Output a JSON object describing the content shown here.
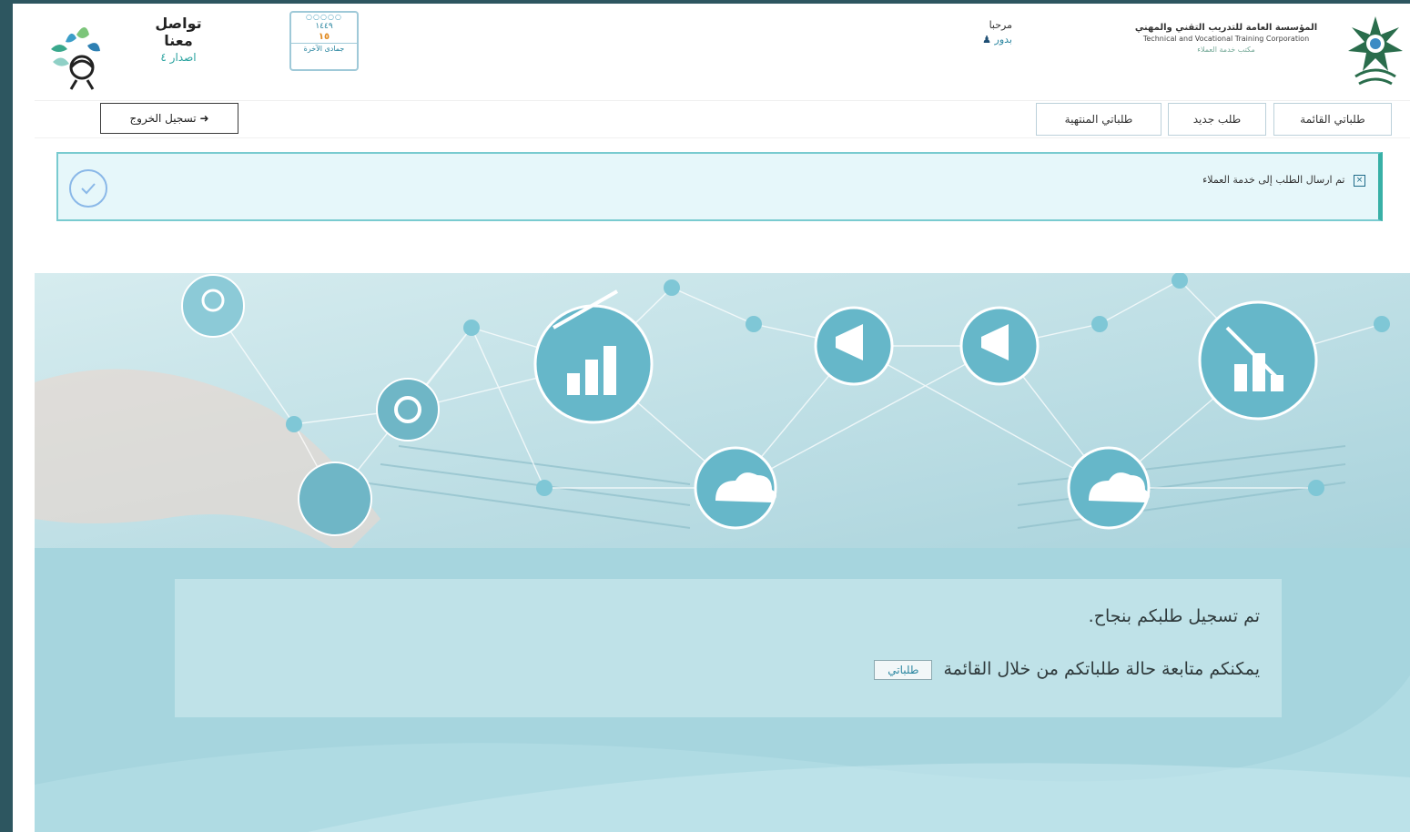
{
  "header": {
    "org_name_ar": "المؤسسة العامة للتدريب التقني والمهني",
    "org_name_en": "Technical and Vocational Training Corporation",
    "org_subtitle": "مكتب خدمة العملاء",
    "greeting": "مرحبا",
    "username": "بدور",
    "calendar": {
      "year": "١٤٤٩",
      "day": "١٥",
      "month": "جمادى الآخرة"
    },
    "app_name_line1": "تواصل",
    "app_name_line2": "معنا",
    "app_release": "اصدار ٤"
  },
  "nav": {
    "tabs": [
      {
        "label": "طلباتي القائمة"
      },
      {
        "label": "طلب جديد"
      },
      {
        "label": "طلباتي المنتهية"
      }
    ],
    "logout_label": "تسجيل الخروج"
  },
  "alert": {
    "message": "تم ارسال الطلب إلى خدمة العملاء",
    "close_symbol": "×"
  },
  "content": {
    "success_message": "تم تسجيل طلبكم بنجاح.",
    "follow_text": "يمكنكم متابعة حالة طلباتكم من خلال القائمة",
    "my_requests_button": "طلباتي"
  },
  "colors": {
    "accent": "#2b86a0",
    "alert_border": "#38b0a6",
    "alert_bg": "#e6f7fa",
    "content_bg": "#a6d5de",
    "frame_bg": "#2d5660"
  },
  "icons": [
    "org-emblem-icon",
    "user-icon",
    "calendar-icon",
    "contact-logo-icon",
    "logout-icon",
    "close-icon",
    "check-circle-icon"
  ]
}
